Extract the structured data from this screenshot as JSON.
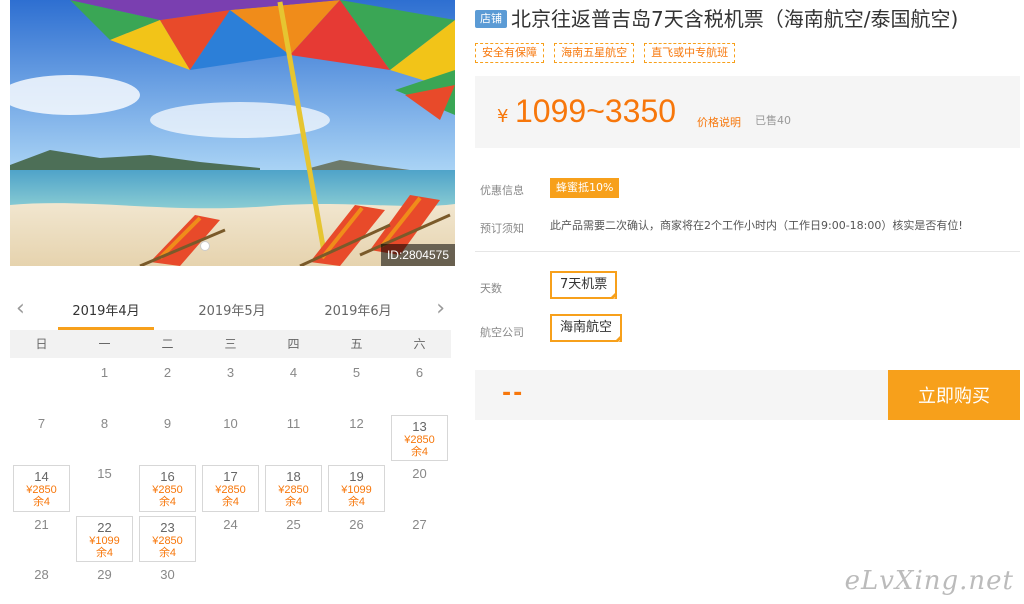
{
  "photo": {
    "id_label": "ID:2804575"
  },
  "calendar": {
    "months": [
      "2019年4月",
      "2019年5月",
      "2019年6月"
    ],
    "weekdays": [
      "日",
      "一",
      "二",
      "三",
      "四",
      "五",
      "六"
    ],
    "days": [
      {
        "d": ""
      },
      {
        "d": "1"
      },
      {
        "d": "2"
      },
      {
        "d": "3"
      },
      {
        "d": "4"
      },
      {
        "d": "5"
      },
      {
        "d": "6"
      },
      {
        "d": "7"
      },
      {
        "d": "8"
      },
      {
        "d": "9"
      },
      {
        "d": "10"
      },
      {
        "d": "11"
      },
      {
        "d": "12"
      },
      {
        "d": "13",
        "price": "¥2850",
        "left": "余4"
      },
      {
        "d": "14",
        "price": "¥2850",
        "left": "余4"
      },
      {
        "d": "15"
      },
      {
        "d": "16",
        "price": "¥2850",
        "left": "余4"
      },
      {
        "d": "17",
        "price": "¥2850",
        "left": "余4"
      },
      {
        "d": "18",
        "price": "¥2850",
        "left": "余4"
      },
      {
        "d": "19",
        "price": "¥1099",
        "left": "余4"
      },
      {
        "d": "20"
      },
      {
        "d": "21"
      },
      {
        "d": "22",
        "price": "¥1099",
        "left": "余4"
      },
      {
        "d": "23",
        "price": "¥2850",
        "left": "余4"
      },
      {
        "d": "24"
      },
      {
        "d": "25"
      },
      {
        "d": "26"
      },
      {
        "d": "27"
      },
      {
        "d": "28"
      },
      {
        "d": "29"
      },
      {
        "d": "30"
      }
    ]
  },
  "product": {
    "shop_tag": "店铺",
    "title": "北京往返普吉岛7天含税机票（海南航空/泰国航空)",
    "tags": [
      "安全有保障",
      "海南五星航空",
      "直飞或中专航班"
    ],
    "currency": "¥",
    "price_range": "1099~3350",
    "price_note": "价格说明",
    "sold": "已售40"
  },
  "info": {
    "discount_label": "优惠信息",
    "discount_badge": "蜂蜜抵10%",
    "notice_label": "预订须知",
    "notice_text": "此产品需要二次确认，商家将在2个工作小时内（工作日9:00-18:00）核实是否有位!"
  },
  "options": {
    "days_label": "天数",
    "days_value": "7天机票",
    "airline_label": "航空公司",
    "airline_value": "海南航空"
  },
  "buy": {
    "total": "--",
    "button": "立即购买"
  },
  "watermark": "eLvXing.net",
  "colors": {
    "accent": "#f7a01b",
    "price": "#f7770b",
    "shop_tag": "#5b9bd5"
  }
}
